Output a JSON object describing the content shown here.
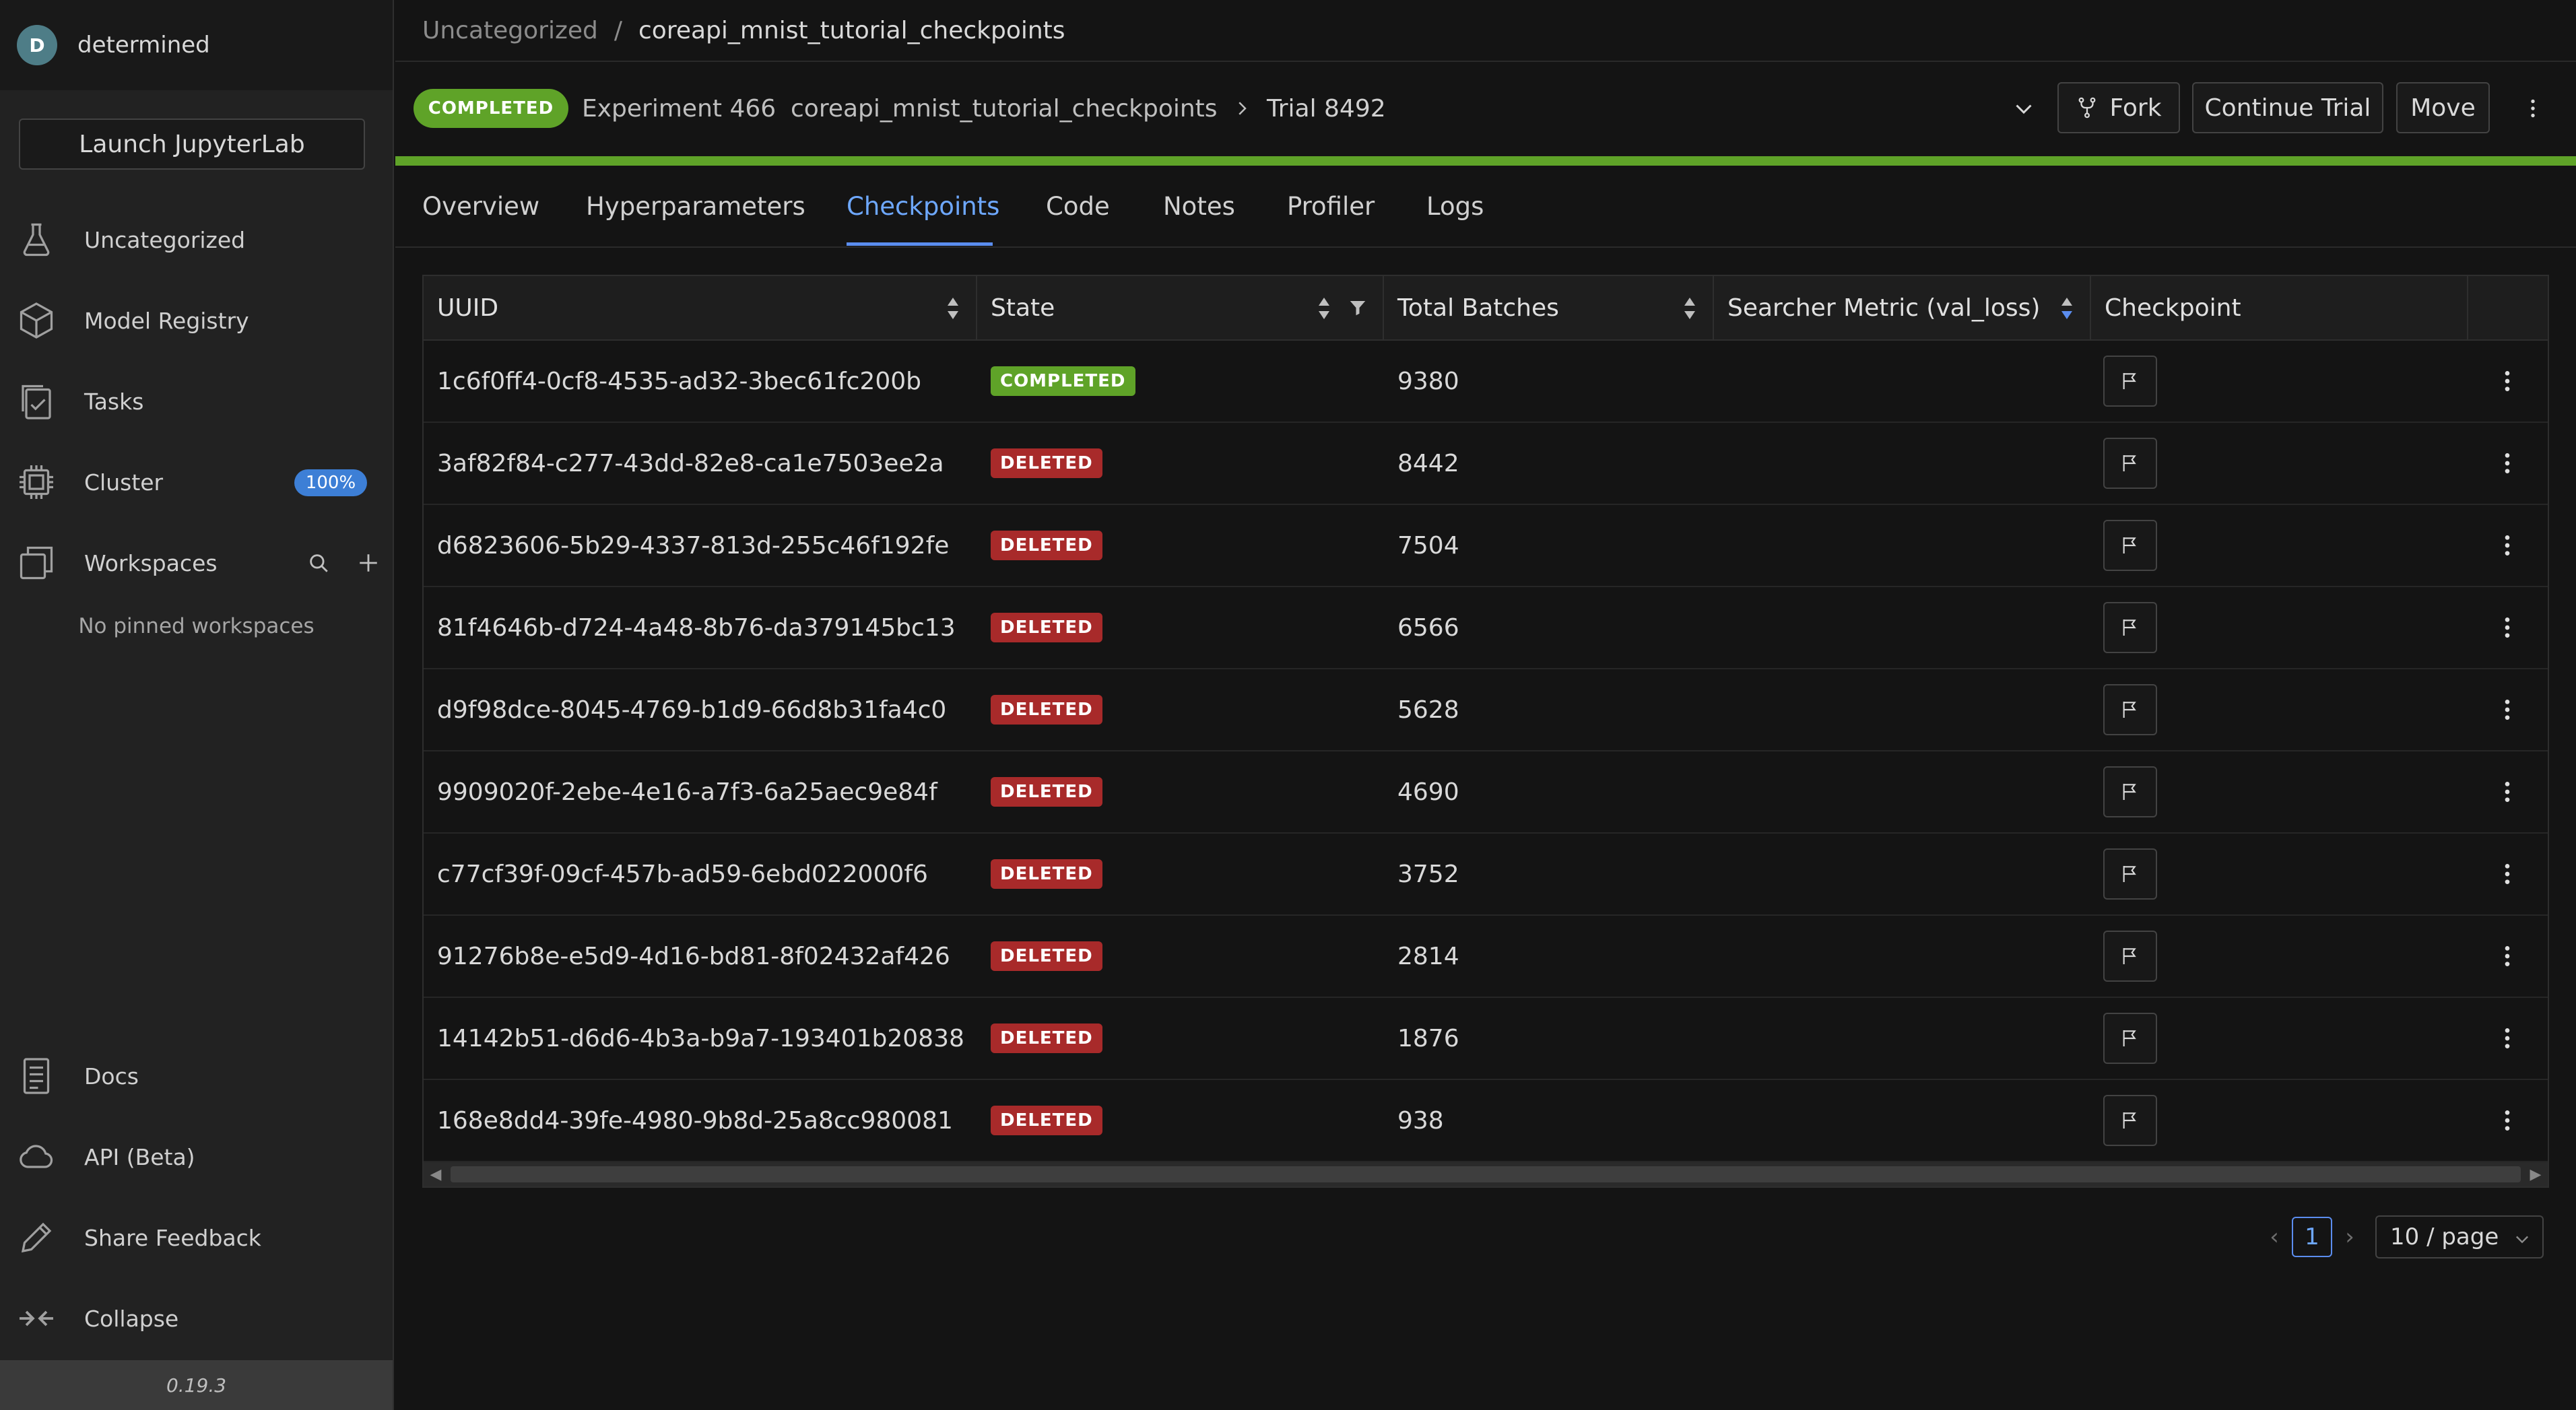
{
  "sidebar": {
    "user": {
      "initial": "D",
      "name": "determined"
    },
    "launch_label": "Launch JupyterLab",
    "items": [
      {
        "label": "Uncategorized",
        "icon": "flask-icon"
      },
      {
        "label": "Model Registry",
        "icon": "cube-icon"
      },
      {
        "label": "Tasks",
        "icon": "tasks-icon"
      },
      {
        "label": "Cluster",
        "icon": "chip-icon",
        "badge": "100%"
      },
      {
        "label": "Workspaces",
        "icon": "workspaces-icon"
      }
    ],
    "no_pinned": "No pinned workspaces",
    "bottom_items": [
      {
        "label": "Docs",
        "icon": "docs-icon"
      },
      {
        "label": "API (Beta)",
        "icon": "cloud-icon"
      },
      {
        "label": "Share Feedback",
        "icon": "pencil-icon"
      },
      {
        "label": "Collapse",
        "icon": "collapse-icon"
      }
    ],
    "version": "0.19.3"
  },
  "breadcrumb": {
    "parent": "Uncategorized",
    "separator": "/",
    "current": "coreapi_mnist_tutorial_checkpoints"
  },
  "header": {
    "status": "COMPLETED",
    "experiment": "Experiment 466",
    "experiment_name": "coreapi_mnist_tutorial_checkpoints",
    "trial": "Trial 8492",
    "buttons": {
      "fork": "Fork",
      "continue": "Continue Trial",
      "move": "Move"
    }
  },
  "tabs": [
    "Overview",
    "Hyperparameters",
    "Checkpoints",
    "Code",
    "Notes",
    "Profiler",
    "Logs"
  ],
  "active_tab": "Checkpoints",
  "table": {
    "columns": [
      "UUID",
      "State",
      "Total Batches",
      "Searcher Metric (val_loss)",
      "Checkpoint"
    ],
    "rows": [
      {
        "uuid": "1c6f0ff4-0cf8-4535-ad32-3bec61fc200b",
        "state": "COMPLETED",
        "batches": "9380",
        "metric": ""
      },
      {
        "uuid": "3af82f84-c277-43dd-82e8-ca1e7503ee2a",
        "state": "DELETED",
        "batches": "8442",
        "metric": ""
      },
      {
        "uuid": "d6823606-5b29-4337-813d-255c46f192fe",
        "state": "DELETED",
        "batches": "7504",
        "metric": ""
      },
      {
        "uuid": "81f4646b-d724-4a48-8b76-da379145bc13",
        "state": "DELETED",
        "batches": "6566",
        "metric": ""
      },
      {
        "uuid": "d9f98dce-8045-4769-b1d9-66d8b31fa4c0",
        "state": "DELETED",
        "batches": "5628",
        "metric": ""
      },
      {
        "uuid": "9909020f-2ebe-4e16-a7f3-6a25aec9e84f",
        "state": "DELETED",
        "batches": "4690",
        "metric": ""
      },
      {
        "uuid": "c77cf39f-09cf-457b-ad59-6ebd022000f6",
        "state": "DELETED",
        "batches": "3752",
        "metric": ""
      },
      {
        "uuid": "91276b8e-e5d9-4d16-bd81-8f02432af426",
        "state": "DELETED",
        "batches": "2814",
        "metric": ""
      },
      {
        "uuid": "14142b51-d6d6-4b3a-b9a7-193401b20838",
        "state": "DELETED",
        "batches": "1876",
        "metric": ""
      },
      {
        "uuid": "168e8dd4-39fe-4980-9b8d-25a8cc980081",
        "state": "DELETED",
        "batches": "938",
        "metric": ""
      }
    ]
  },
  "pagination": {
    "current_page": "1",
    "page_size": "10 / page"
  },
  "colors": {
    "success": "#5fa328",
    "danger": "#a82a2a",
    "accent": "#5b8def",
    "background": "#141414",
    "sidebar": "#222222"
  }
}
